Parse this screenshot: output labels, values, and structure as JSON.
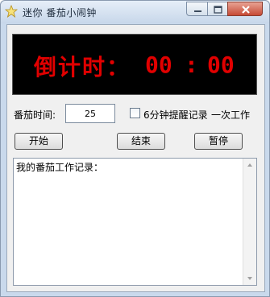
{
  "window": {
    "title": "迷你 番茄小闹钟",
    "icons": {
      "app": "star-icon",
      "minimize": "minimize-icon",
      "maximize": "maximize-icon",
      "close": "close-icon"
    }
  },
  "timer": {
    "label": "倒计时：",
    "minutes": "00",
    "separator": ":",
    "seconds": "00",
    "color": "#e10000"
  },
  "settings": {
    "time_label": "番茄时间:",
    "time_value": "25",
    "remind_label": "6分钟提醒记录",
    "remind_checked": false,
    "once_label": "一次工作"
  },
  "buttons": {
    "start": "开始",
    "end": "结束",
    "pause": "暂停"
  },
  "log": {
    "text": "我的番茄工作记录："
  }
}
